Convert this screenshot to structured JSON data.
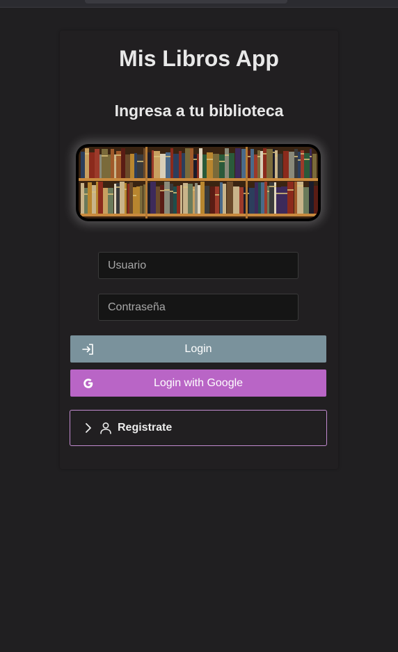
{
  "app": {
    "title": "Mis Libros App",
    "subtitle": "Ingresa a tu biblioteca",
    "hero_image": "bookshelf-image"
  },
  "form": {
    "username_placeholder": "Usuario",
    "username_value": "",
    "password_placeholder": "Contraseña",
    "password_value": ""
  },
  "buttons": {
    "login": {
      "label": "Login",
      "icon": "login-icon",
      "color": "#7a929c"
    },
    "google": {
      "label": "Login with Google",
      "icon": "google-icon",
      "color": "#b965c6"
    },
    "register": {
      "label": "Registrate",
      "icons": [
        "chevron-right-icon",
        "user-icon"
      ],
      "border_color": "#c38cd1"
    }
  },
  "theme": {
    "background": "#201f21",
    "card": "#211f21",
    "input_bg": "#151515"
  }
}
